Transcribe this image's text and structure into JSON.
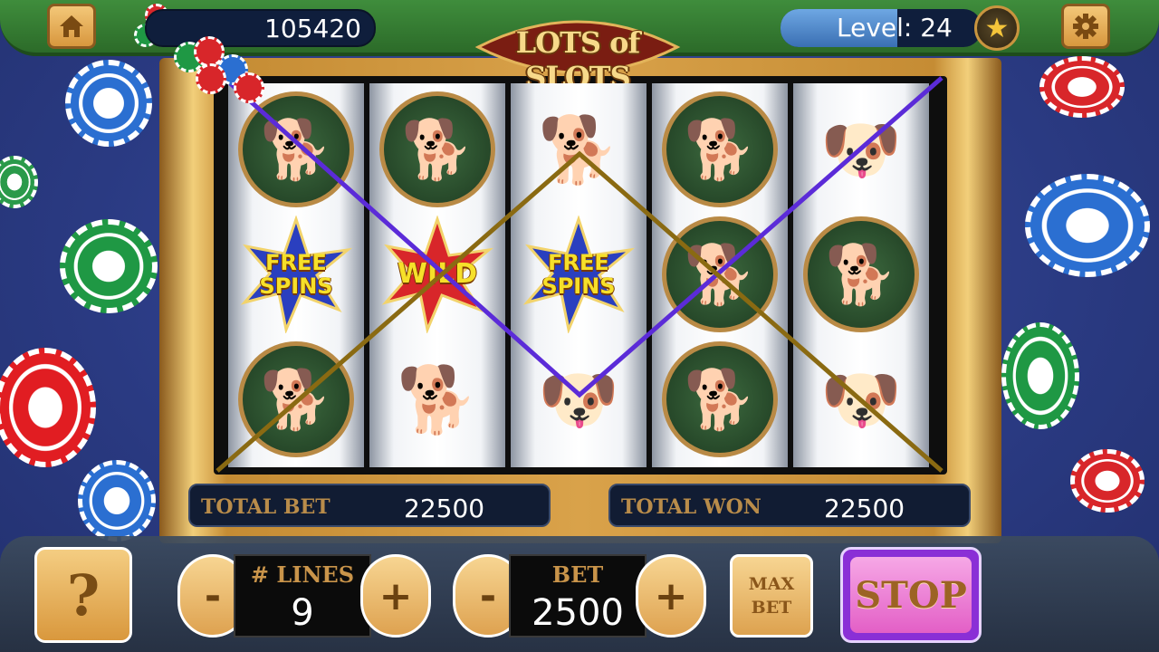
{
  "game": {
    "logo_text": "LOTS of SLOTS",
    "coins": "105420",
    "level_text": "Level: 24",
    "level_progress_fraction": 0.58
  },
  "buttons": {
    "home_icon": "home-icon",
    "settings_icon": "gear-icon",
    "help_label": "?",
    "minus_label": "-",
    "plus_label": "+",
    "max_bet_line1": "MAX",
    "max_bet_line2": "BET",
    "stop_label": "STOP"
  },
  "reels": [
    [
      "collie-dog",
      "free-spins",
      "corgi-dog"
    ],
    [
      "corgi-dog",
      "wild",
      "scottish-terrier-dog"
    ],
    [
      "scottish-terrier-dog",
      "free-spins",
      "bulldog"
    ],
    [
      "corgi-dog",
      "collie-dog",
      "pomeranian-dog"
    ],
    [
      "golden-retriever-dog",
      "pomeranian-dog",
      "pitbull-dog"
    ]
  ],
  "symbol_labels": {
    "free_spins_top": "FREE",
    "free_spins_bottom": "SPINS",
    "wild": "WILD"
  },
  "paylines_colors": {
    "purple": "#5b2bd8",
    "gold": "#8a6a12"
  },
  "totals": {
    "bet_label": "TOTAL BET",
    "bet_value": "22500",
    "won_label": "TOTAL WON",
    "won_value": "22500"
  },
  "controls": {
    "lines_label": "# LINES",
    "lines_value": "9",
    "bet_label": "BET",
    "bet_value": "2500"
  },
  "colors": {
    "felt": "#2a3a82",
    "top_bar": "#3f8d3c",
    "frame_gold": "#d9a24a",
    "stop_purple": "#8a2fd6"
  }
}
